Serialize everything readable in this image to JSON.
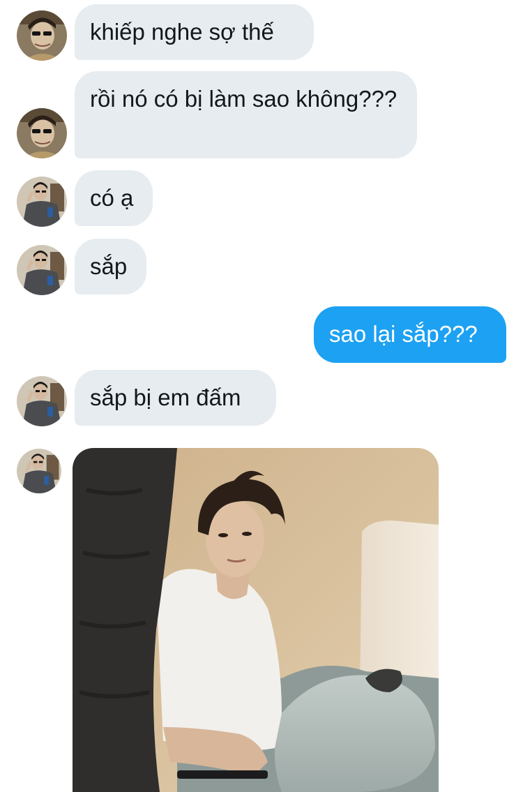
{
  "conversation": {
    "messages": [
      {
        "sender": "them",
        "text": "khiếp nghe sợ thế"
      },
      {
        "sender": "them",
        "text": "rồi nó có bị làm sao không???"
      },
      {
        "sender": "them",
        "text": "có ạ"
      },
      {
        "sender": "them",
        "text": "sắp"
      },
      {
        "sender": "me",
        "text": "sao lại sắp???"
      },
      {
        "sender": "them",
        "text": "sắp bị em đấm"
      },
      {
        "sender": "them",
        "type": "image"
      }
    ],
    "colors": {
      "incoming_bubble": "#e6ecf0",
      "outgoing_bubble": "#1da1f2",
      "incoming_text": "#14171a",
      "outgoing_text": "#ffffff"
    }
  }
}
